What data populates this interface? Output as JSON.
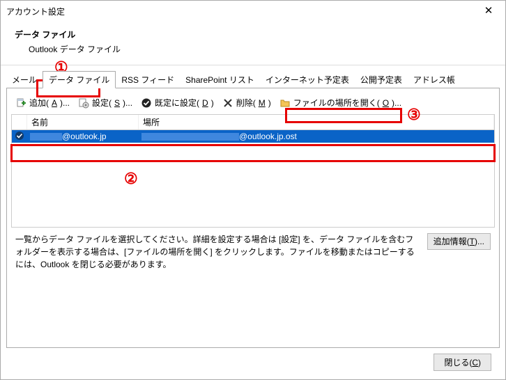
{
  "window": {
    "title": "アカウント設定"
  },
  "header": {
    "title": "データ ファイル",
    "subtitle": "Outlook データ ファイル"
  },
  "tabs": [
    {
      "label": "メール",
      "active": false
    },
    {
      "label": "データ ファイル",
      "active": true
    },
    {
      "label": "RSS フィード",
      "active": false
    },
    {
      "label": "SharePoint リスト",
      "active": false
    },
    {
      "label": "インターネット予定表",
      "active": false
    },
    {
      "label": "公開予定表",
      "active": false
    },
    {
      "label": "アドレス帳",
      "active": false
    }
  ],
  "toolbar": {
    "add": {
      "label_pre": "追加(",
      "accel": "A",
      "label_post": ")..."
    },
    "set": {
      "label_pre": "設定(",
      "accel": "S",
      "label_post": ")..."
    },
    "def": {
      "label_pre": "既定に設定(",
      "accel": "D",
      "label_post": ")"
    },
    "del": {
      "label_pre": "削除(",
      "accel": "M",
      "label_post": ")"
    },
    "open": {
      "label_pre": "ファイルの場所を開く(",
      "accel": "O",
      "label_post": ")..."
    }
  },
  "columns": {
    "name": "名前",
    "location": "場所"
  },
  "rows": [
    {
      "name_suffix": "@outlook.jp",
      "location_suffix": "@outlook.jp.ost",
      "selected": true,
      "default": true
    }
  ],
  "hint": "一覧からデータ ファイルを選択してください。詳細を設定する場合は [設定] を、データ ファイルを含むフォルダーを表示する場合は、[ファイルの場所を開く] をクリックします。ファイルを移動またはコピーするには、Outlook を閉じる必要があります。",
  "info_button": {
    "label_pre": "追加情報(",
    "accel": "T",
    "label_post": ")..."
  },
  "close_button": {
    "label_pre": "閉じる(",
    "accel": "C",
    "label_post": ")"
  },
  "annotations": {
    "n1": "①",
    "n2": "②",
    "n3": "③"
  }
}
